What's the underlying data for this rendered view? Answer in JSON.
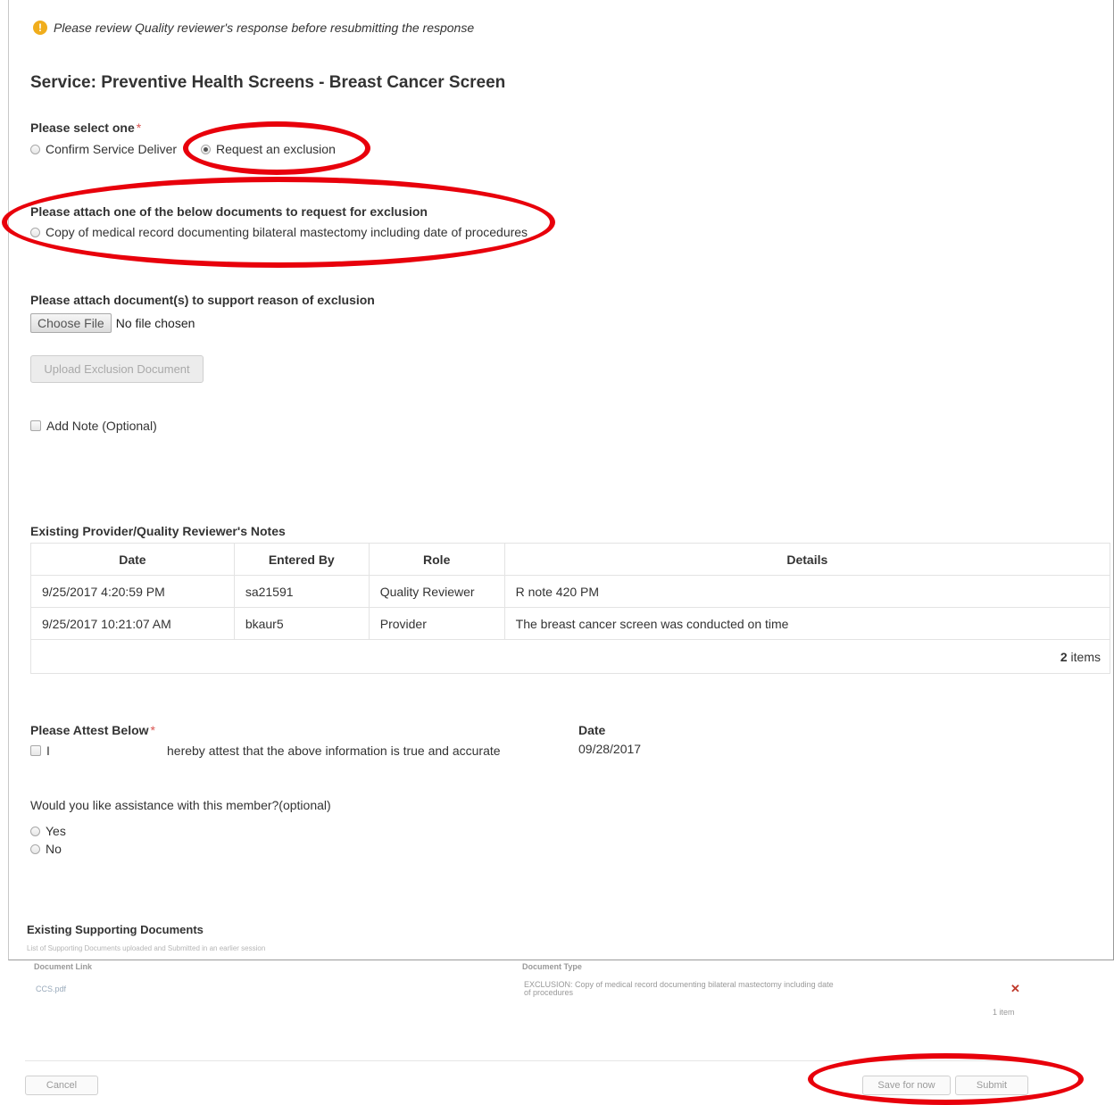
{
  "warning": {
    "icon": "exclamation-circle-icon",
    "text": "Please review Quality reviewer's response before resubmitting the response"
  },
  "service_title": "Service: Preventive Health Screens - Breast Cancer Screen",
  "select": {
    "label": "Please select one",
    "required_mark": "*",
    "options": [
      {
        "label": "Confirm Service Deliver",
        "selected": false
      },
      {
        "label": "Request an exclusion",
        "selected": true
      }
    ]
  },
  "attach_docs": {
    "label": "Please attach one of the below documents to request for exclusion",
    "option": "Copy of medical record documenting bilateral mastectomy including date of procedures"
  },
  "support": {
    "label": "Please attach document(s) to support reason of exclusion",
    "choose_file": "Choose File",
    "no_file": "No file chosen",
    "upload_button": "Upload Exclusion Document"
  },
  "add_note": "Add Note (Optional)",
  "notes": {
    "title": "Existing Provider/Quality Reviewer's Notes",
    "headers": [
      "Date",
      "Entered By",
      "Role",
      "Details"
    ],
    "rows": [
      [
        "9/25/2017 4:20:59 PM",
        "sa21591",
        "Quality Reviewer",
        "R note 420 PM"
      ],
      [
        "9/25/2017 10:21:07 AM",
        "bkaur5",
        "Provider",
        "The breast cancer screen was conducted on time"
      ]
    ],
    "count": "2",
    "count_label": "items"
  },
  "attest": {
    "label": "Please Attest Below",
    "required_mark": "*",
    "prefix": "I",
    "text": "hereby attest that the above information is true and accurate",
    "date_label": "Date",
    "date_value": "09/28/2017"
  },
  "assist": {
    "question": "Would you like assistance with this member?(optional)",
    "options": [
      "Yes",
      "No"
    ]
  },
  "supporting": {
    "title": "Existing Supporting Documents",
    "subtitle": "List of Supporting Documents uploaded and Submitted in an earlier session",
    "headers": [
      "Document Link",
      "Document Type"
    ],
    "row": {
      "link": "CCS.pdf",
      "type_line1": "EXCLUSION: Copy of medical record documenting bilateral mastectomy including date",
      "type_line2": "of procedures",
      "delete_icon": "close-icon"
    },
    "count": "1 item"
  },
  "actions": {
    "cancel": "Cancel",
    "save": "Save for now",
    "submit": "Submit"
  },
  "colors": {
    "highlight": "#e8000b",
    "required": "#d9534f",
    "warning": "#f0ad1c"
  }
}
